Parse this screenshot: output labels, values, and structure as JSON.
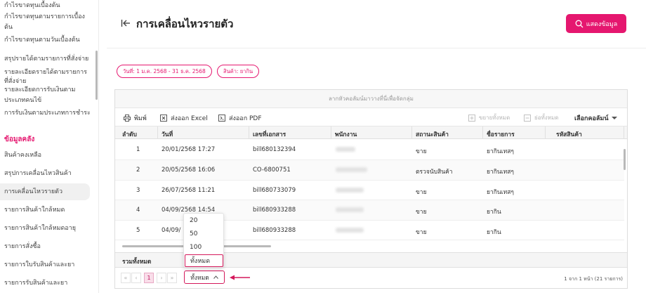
{
  "sidebar": {
    "items_top": [
      "กำไรขาดทุนเบื้องต้น",
      "กำไรขาดทุนตามรายการเบื้อง",
      "ต้น",
      "กำไรขาดทุนตามวันเบื้องต้น",
      "สรุปรายได้ตามรายการที่สั่งจ่าย",
      "รายละเอียดรายได้ตามรายการ",
      "ที่สั่งจ่าย",
      "รายละเอียดการรับเงินตาม",
      "ประเภทคนไข้",
      "การรับเงินตามประเภทการชำระ"
    ],
    "section_title": "ข้อมูลคลัง",
    "items": [
      "สินค้าคงเหลือ",
      "สรุปการเคลื่อนไหวสินค้า",
      "การเคลื่อนไหวรายตัว",
      "รายการสินค้าใกล้หมด",
      "รายการสินค้าใกล้หมดอายุ",
      "รายการสั่งซื้อ",
      "รายการใบรับสินค้าและยา",
      "รายการรับสินค้าและยา"
    ]
  },
  "header": {
    "title": "การเคลื่อนไหวรายตัว",
    "show_button": "แสดงข้อมูล"
  },
  "filters": {
    "date_chip": "วันที่: 1 ม.ค. 2568 - 31 ธ.ค. 2568",
    "product_chip": "สินค้า: ยากิน"
  },
  "grid": {
    "group_hint": "ลากหัวคอลัมน์มาวางที่นี่เพื่อจัดกลุ่ม",
    "toolbar": {
      "print": "พิมพ์",
      "export_excel": "ส่งออก Excel",
      "export_pdf": "ส่งออก PDF",
      "expand_all": "ขยายทั้งหมด",
      "collapse_all": "ย่อทั้งหมด",
      "choose_columns": "เลือกคอลัมน์"
    },
    "columns": [
      "ลำดับ",
      "วันที่",
      "เลขที่เอกสาร",
      "พนักงาน",
      "สถานะสินค้า",
      "ชื่อรายการ",
      "รหัสสินค้า"
    ],
    "rows": [
      {
        "no": "1",
        "date": "20/01/2568 17:27",
        "doc": "bill680132394",
        "status": "ขาย",
        "item": "ยากินเทสๆ"
      },
      {
        "no": "2",
        "date": "20/05/2568 16:06",
        "doc": "CO-6800751",
        "status": "ตรวจนับสินค้า",
        "item": "ยากินเทสๆ"
      },
      {
        "no": "3",
        "date": "26/07/2568 11:21",
        "doc": "bill680733079",
        "status": "ขาย",
        "item": "ยากินเทสๆ"
      },
      {
        "no": "4",
        "date": "04/09/2568 14:54",
        "doc": "bill680933288",
        "status": "ขาย",
        "item": "ยากิน"
      },
      {
        "no": "5",
        "date": "04/09/",
        "doc": "bill680933288",
        "status": "ขาย",
        "item": "ยากิน"
      }
    ],
    "total_label": "รวมทั้งหมด",
    "pager": {
      "first": "«",
      "prev": "‹",
      "current_page": "1",
      "next": "›",
      "last": "»",
      "page_size": "ทั้งหมด",
      "info": "1 จาก 1 หน้า (21 รายการ)"
    },
    "page_size_options": [
      "20",
      "50",
      "100",
      "ทั้งหมด"
    ]
  },
  "colors": {
    "accent": "#e5176f",
    "highlight": "#d4185b"
  }
}
